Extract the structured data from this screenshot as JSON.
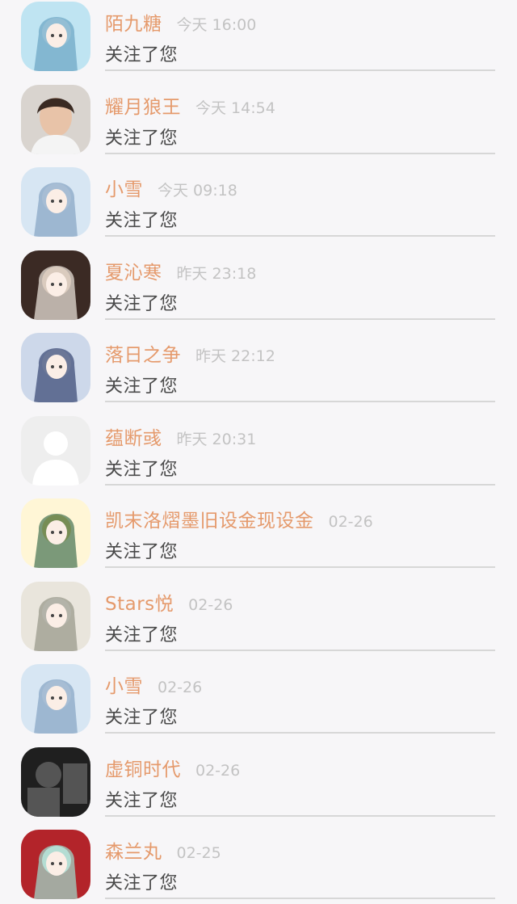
{
  "items": [
    {
      "name": "陌九糖",
      "time": "今天 16:00",
      "action": "关注了您",
      "avatar": "anime-girl-moon-icon",
      "colors": [
        "#bfe4f2",
        "#6fa8c6",
        "#ffffff"
      ]
    },
    {
      "name": "耀月狼王",
      "time": "今天 14:54",
      "action": "关注了您",
      "avatar": "boy-portrait-icon",
      "colors": [
        "#d9d4cf",
        "#3a2a22",
        "#e8c3a8"
      ]
    },
    {
      "name": "小雪",
      "time": "今天 09:18",
      "action": "关注了您",
      "avatar": "anime-girl-white-hair-icon",
      "colors": [
        "#d7e6f3",
        "#8aa7c6",
        "#ffffff"
      ]
    },
    {
      "name": "夏沁寒",
      "time": "昨天 23:18",
      "action": "关注了您",
      "avatar": "anime-girl-flowers-icon",
      "colors": [
        "#3b2a24",
        "#e7dfd6",
        "#b58f7a"
      ]
    },
    {
      "name": "落日之争",
      "time": "昨天 22:12",
      "action": "关注了您",
      "avatar": "anime-girl-blue-icon",
      "colors": [
        "#cdd8ea",
        "#3d4d78",
        "#f4f4f4"
      ]
    },
    {
      "name": "蕴断彧",
      "time": "昨天 20:31",
      "action": "关注了您",
      "avatar": "default-user-silhouette-icon",
      "colors": [
        "#eeeeee",
        "#ffffff",
        "#ffffff"
      ]
    },
    {
      "name": "凯末洛熠墨旧设金现设金",
      "time": "02-26",
      "action": "关注了您",
      "avatar": "anime-boy-green-hat-icon",
      "colors": [
        "#fff6d6",
        "#4f7a5a",
        "#f0c84a"
      ]
    },
    {
      "name": "Stars悦",
      "time": "02-26",
      "action": "关注了您",
      "avatar": "anime-girl-silver-hair-icon",
      "colors": [
        "#e9e5dc",
        "#9a9a8c",
        "#ffffff"
      ]
    },
    {
      "name": "小雪",
      "time": "02-26",
      "action": "关注了您",
      "avatar": "anime-girl-white-hair-icon",
      "colors": [
        "#d7e6f3",
        "#8aa7c6",
        "#ffffff"
      ]
    },
    {
      "name": "虚铜时代",
      "time": "02-26",
      "action": "关注了您",
      "avatar": "dark-photo-icon",
      "colors": [
        "#1f1f1f",
        "#555555",
        "#8a8a8a"
      ]
    },
    {
      "name": "森兰丸",
      "time": "02-25",
      "action": "关注了您",
      "avatar": "anime-girl-red-bg-icon",
      "colors": [
        "#b3242a",
        "#9fd6c8",
        "#f4f4f4"
      ]
    }
  ]
}
